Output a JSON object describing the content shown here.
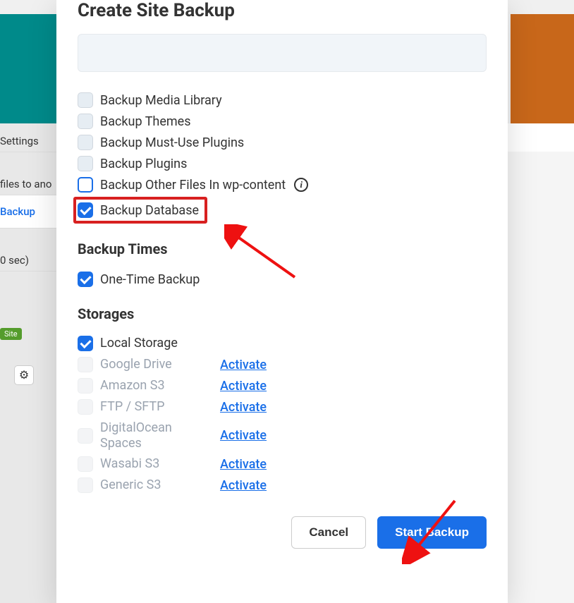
{
  "modal": {
    "title": "Create Site Backup",
    "backup_options": [
      {
        "label": "Backup Media Library",
        "checked": false
      },
      {
        "label": "Backup Themes",
        "checked": false
      },
      {
        "label": "Backup Must-Use Plugins",
        "checked": false
      },
      {
        "label": "Backup Plugins",
        "checked": false
      },
      {
        "label": "Backup Other Files In wp-content",
        "checked": false,
        "outlined": true,
        "info": true
      },
      {
        "label": "Backup Database",
        "checked": true,
        "highlighted": true
      }
    ],
    "times_heading": "Backup Times",
    "times_options": [
      {
        "label": "One-Time Backup",
        "checked": true
      }
    ],
    "storages_heading": "Storages",
    "storages": [
      {
        "name": "Local Storage",
        "checked": true,
        "active": true
      },
      {
        "name": "Google Drive",
        "activate": "Activate"
      },
      {
        "name": "Amazon S3",
        "activate": "Activate"
      },
      {
        "name": "FTP / SFTP",
        "activate": "Activate"
      },
      {
        "name": "DigitalOcean Spaces",
        "activate": "Activate"
      },
      {
        "name": "Wasabi S3",
        "activate": "Activate"
      },
      {
        "name": "Generic S3",
        "activate": "Activate"
      }
    ],
    "cancel_label": "Cancel",
    "start_label": "Start Backup"
  },
  "bg": {
    "settings": "Settings",
    "files_to": "files to ano",
    "backup": "Backup",
    "zero_sec": "0 sec)",
    "site_badge": "Site"
  }
}
